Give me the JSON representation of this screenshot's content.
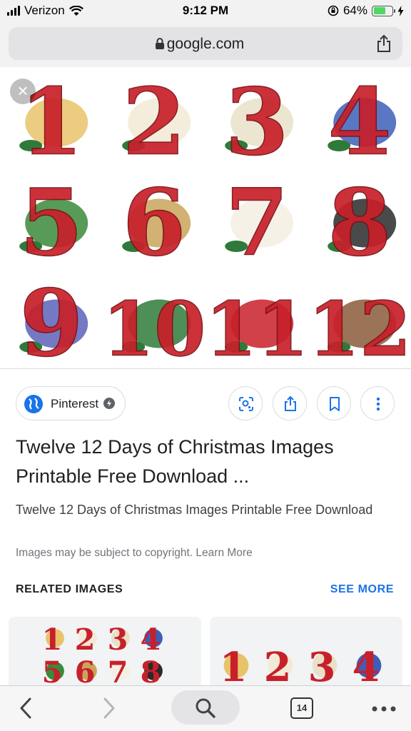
{
  "status_bar": {
    "carrier": "Verizon",
    "time": "9:12 PM",
    "battery_percent": "64%",
    "battery_level": 0.64,
    "icons": [
      "signal-icon",
      "wifi-icon",
      "orientation-lock-icon",
      "battery-icon",
      "charging-icon"
    ]
  },
  "address_bar": {
    "url": "google.com",
    "icons": [
      "lock-icon",
      "share-icon"
    ]
  },
  "hero": {
    "numbers": [
      "1",
      "2",
      "3",
      "4",
      "5",
      "6",
      "7",
      "8",
      "9",
      "10",
      "11",
      "12"
    ],
    "accent_red": "#c8202a",
    "close_glyph": "×"
  },
  "source": {
    "name": "Pinterest",
    "icons": [
      "globe-icon",
      "verified-icon"
    ]
  },
  "actions": [
    "lens-icon",
    "share-icon",
    "bookmark-icon",
    "more-vert-icon"
  ],
  "result": {
    "title": "Twelve 12 Days of Christmas Images Printable Free Download ...",
    "description": "Twelve 12 Days of Christmas Images Printable Free Download",
    "copyright_notice": "Images may be subject to copyright. Learn More"
  },
  "related": {
    "heading": "RELATED IMAGES",
    "see_more": "SEE MORE",
    "link_color": "#1a73e8"
  },
  "toolbar": {
    "tab_count": "14",
    "icons": [
      "back-icon",
      "forward-icon",
      "search-icon",
      "tabs-icon",
      "more-horiz-icon"
    ]
  }
}
